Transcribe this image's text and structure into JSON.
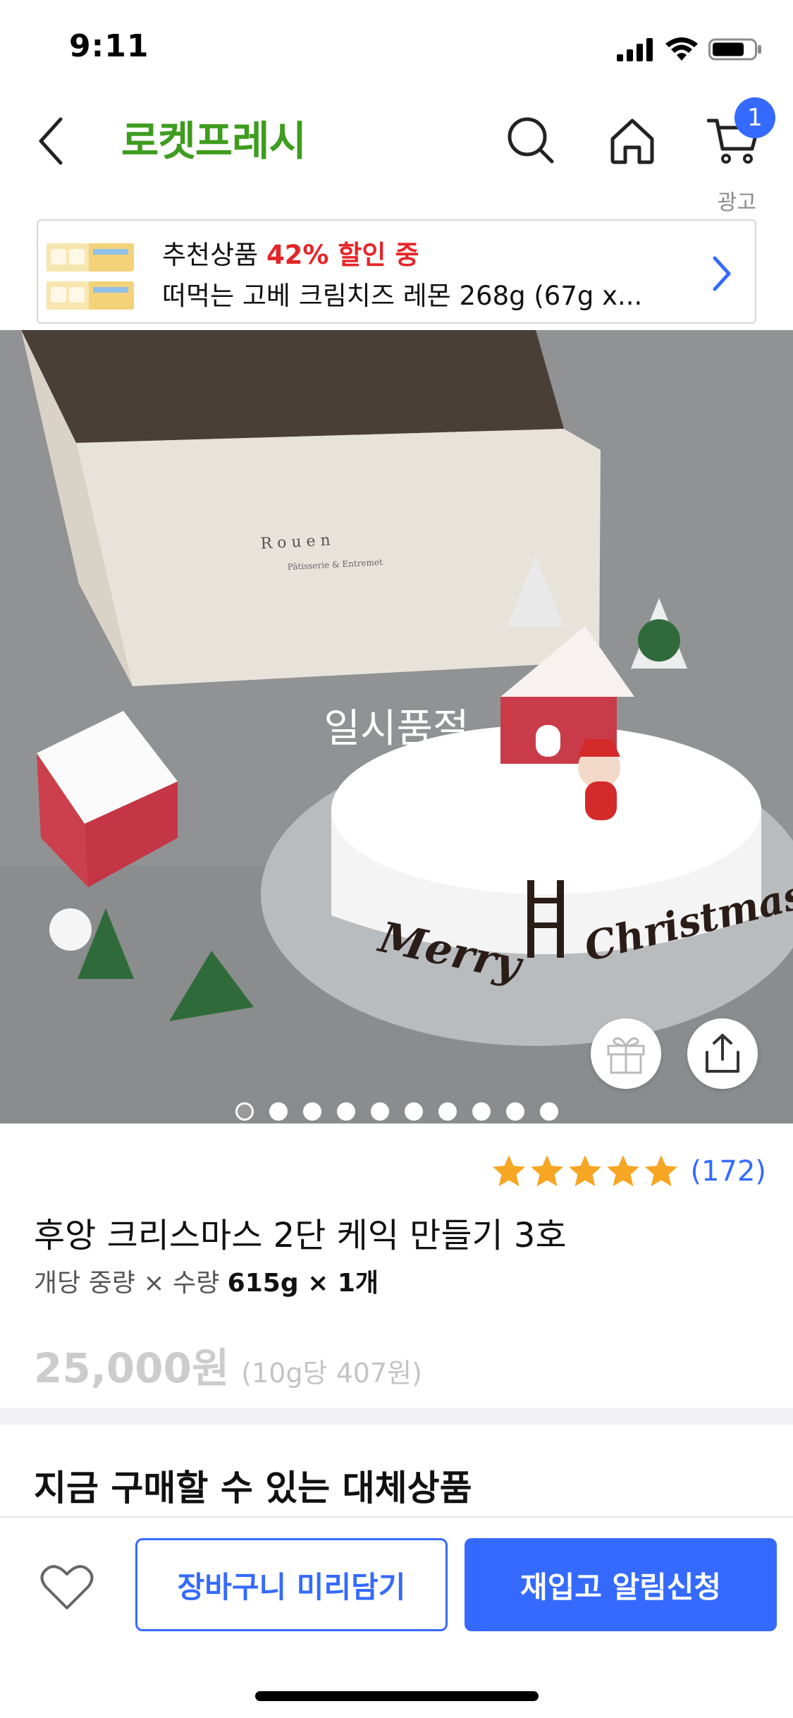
{
  "status_bar": {
    "time": "9:11"
  },
  "header": {
    "brand": "로켓프레시",
    "cart_count": "1",
    "icons": [
      "back-chevron-icon",
      "search-icon",
      "home-icon",
      "cart-icon"
    ]
  },
  "ad": {
    "label": "광고",
    "prefix": "추천상품",
    "discount": "42% 할인 중",
    "product_name": "떠먹는 고베 크림치즈 레몬 268g (67g x..."
  },
  "product_image": {
    "soldout_label": "일시품절",
    "slide_count": 10,
    "active_slide": 1,
    "box_text": "R o u e n",
    "box_subtext": "Pâtisserie & Entremet",
    "cake_text_left": "Merry",
    "cake_text_right": "Christmas"
  },
  "product": {
    "rating": 5,
    "review_count": "(172)",
    "title": "후앙 크리스마스 2단 케익 만들기 3호",
    "unit_label": "개당 중량 × 수량",
    "unit_value": "615g × 1개",
    "price": "25,000원",
    "unit_price": "(10g당 407원)"
  },
  "section": {
    "alt_title": "지금 구매할 수 있는 대체상품"
  },
  "bottom_bar": {
    "cart_button": "장바구니 미리담기",
    "restock_button": "재입고 알림신청"
  },
  "colors": {
    "brand_green": "#3e9c1e",
    "accent_blue": "#346aff",
    "discount_red": "#e52528",
    "star_orange": "#f6a623"
  }
}
